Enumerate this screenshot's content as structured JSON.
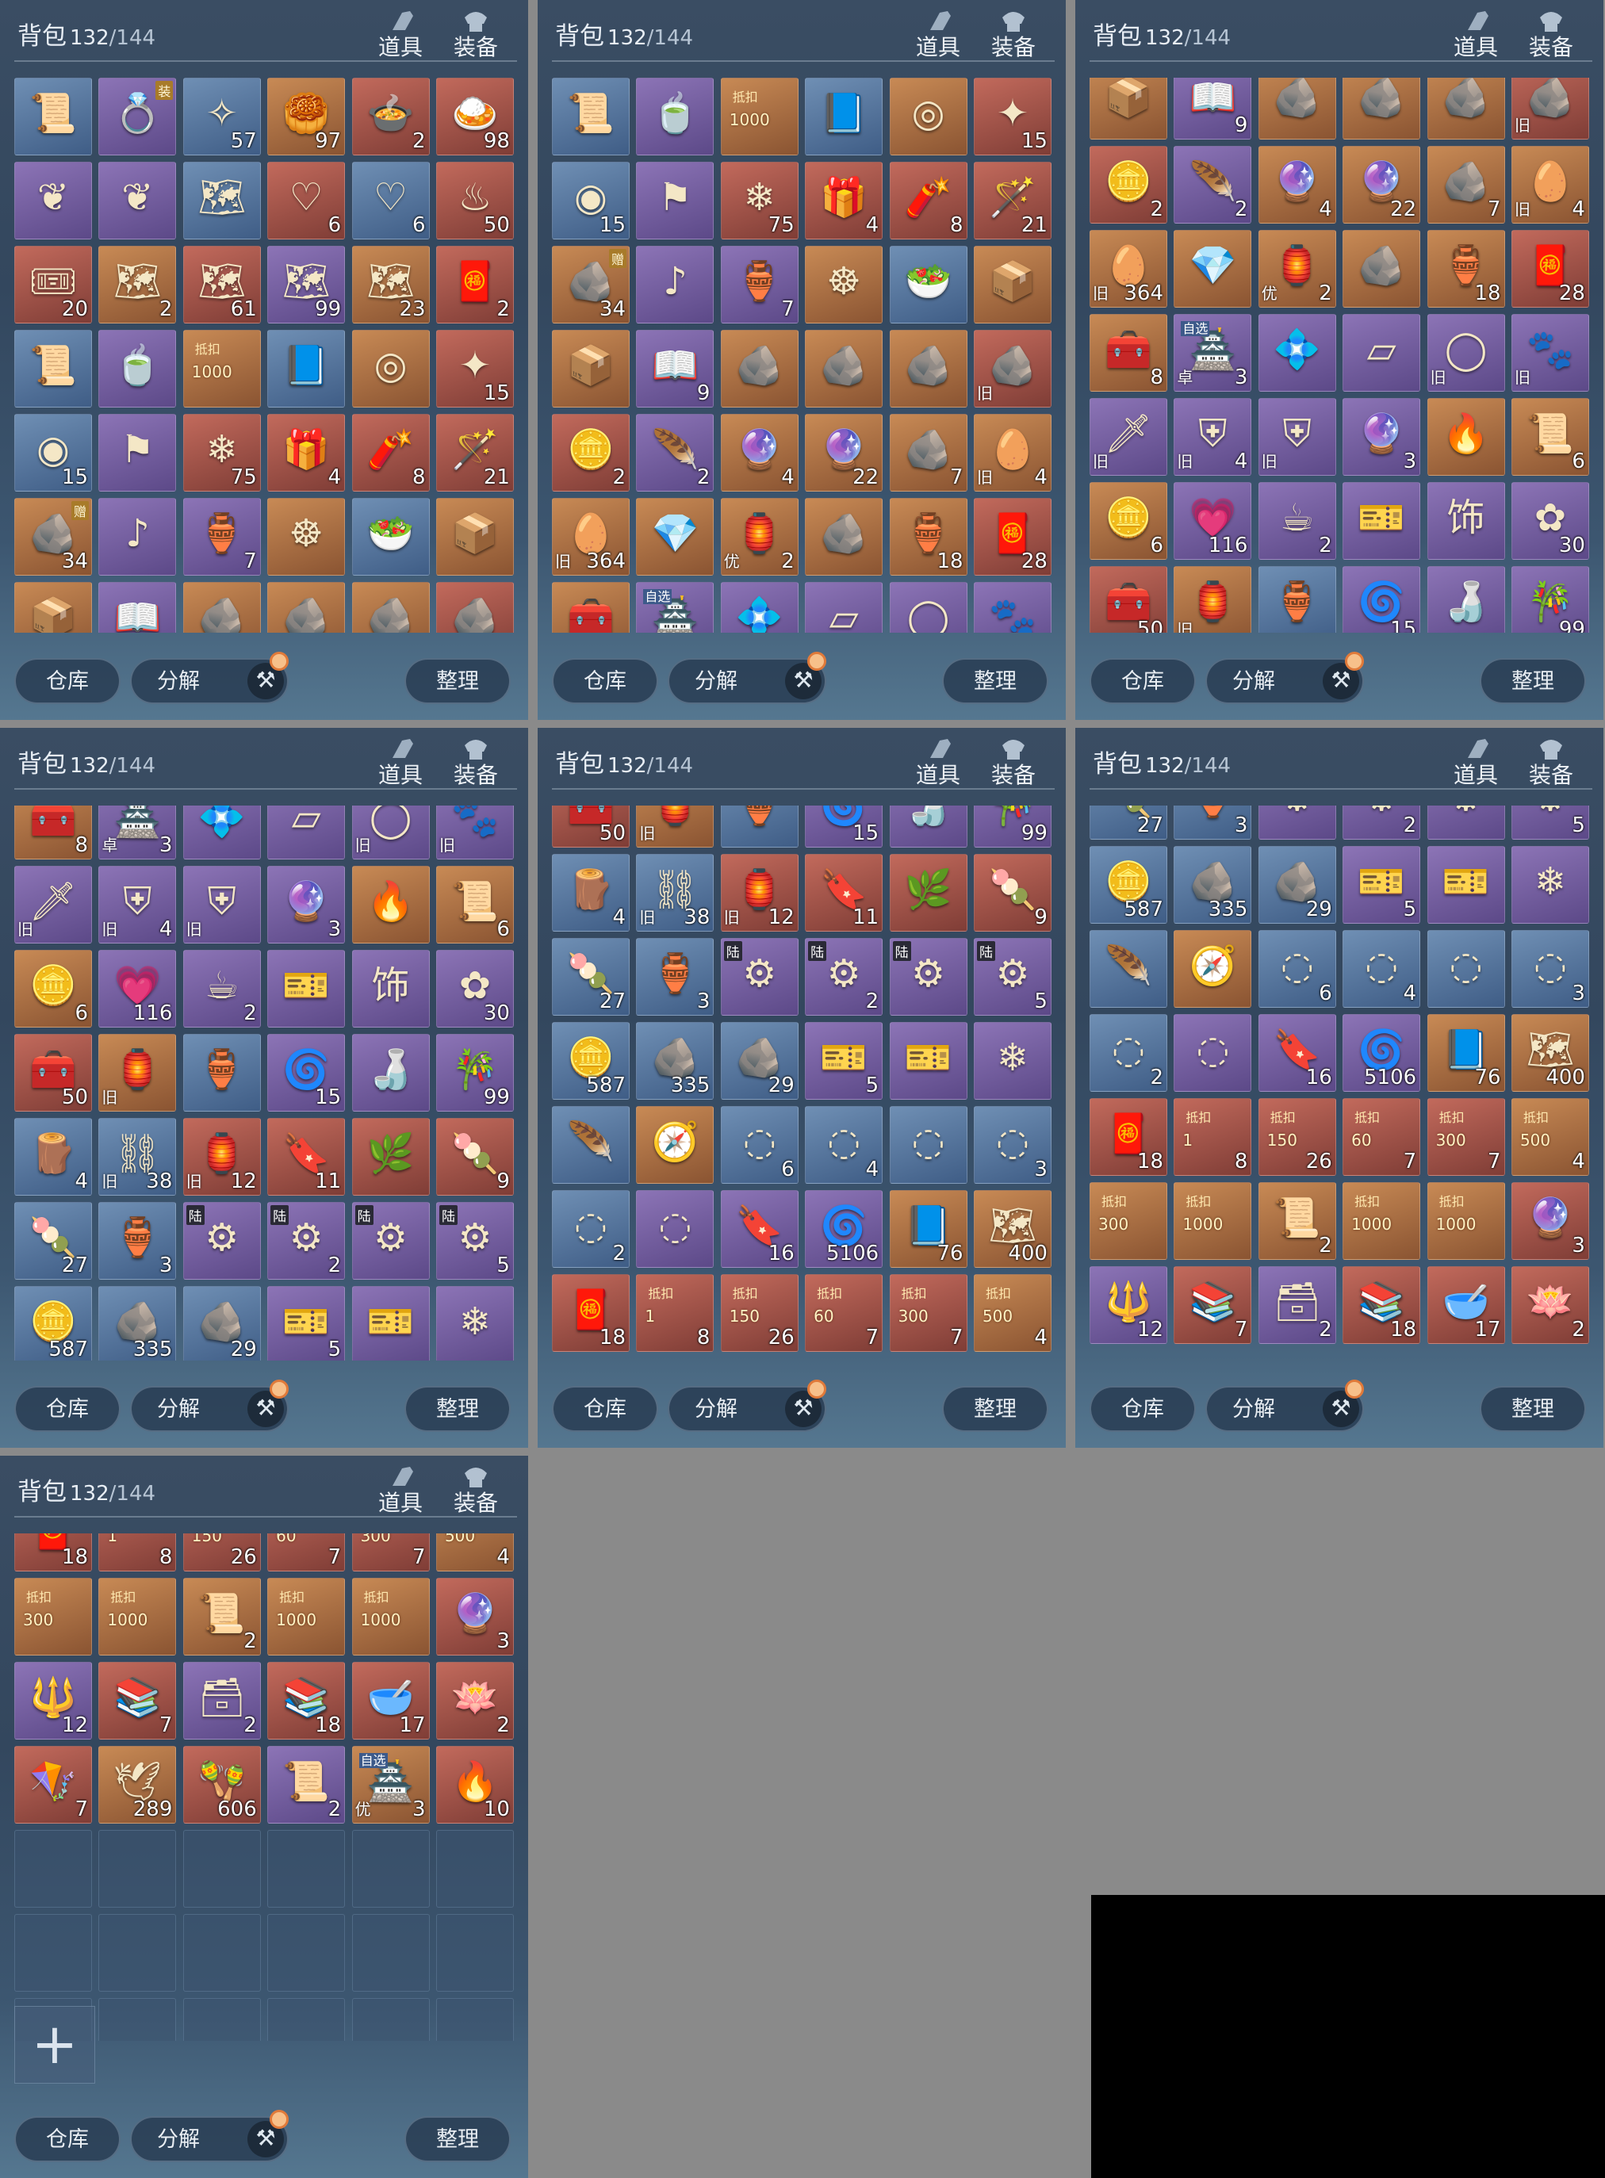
{
  "header": {
    "title": "背包",
    "used": "132",
    "max": "/144",
    "tab1": "道具",
    "tab2": "装备"
  },
  "footer": {
    "warehouse": "仓库",
    "decompose": "分解",
    "sort": "整理",
    "hammer": "⚒"
  },
  "plus": "+",
  "colors": {
    "blue": "#4f6f99",
    "purple": "#6e5a9e",
    "orange": "#a56a40",
    "red": "#9c4e45",
    "black": "#000000"
  },
  "items": [
    {
      "c": "blue",
      "i": "📜"
    },
    {
      "c": "purple",
      "i": "💍",
      "cr": "装"
    },
    {
      "c": "blue",
      "i": "✧",
      "q": "57"
    },
    {
      "c": "orange",
      "i": "🥮",
      "q": "97"
    },
    {
      "c": "red",
      "i": "🍲",
      "q": "2"
    },
    {
      "c": "red",
      "i": "🍛",
      "q": "98"
    },
    {
      "c": "purple",
      "i": "❦"
    },
    {
      "c": "purple",
      "i": "❦"
    },
    {
      "c": "blue",
      "i": "🗺"
    },
    {
      "c": "red",
      "i": "♡",
      "q": "6"
    },
    {
      "c": "blue",
      "i": "♡",
      "q": "6"
    },
    {
      "c": "red",
      "i": "♨",
      "q": "50"
    },
    {
      "c": "red",
      "i": "🎟",
      "q": "20"
    },
    {
      "c": "orange",
      "i": "🗺",
      "q": "2"
    },
    {
      "c": "red",
      "i": "🗺",
      "q": "61"
    },
    {
      "c": "purple",
      "i": "🗺",
      "q": "99"
    },
    {
      "c": "orange",
      "i": "🗺",
      "q": "23"
    },
    {
      "c": "red",
      "i": "🧧",
      "q": "2"
    },
    {
      "c": "blue",
      "i": "📜"
    },
    {
      "c": "purple",
      "i": "🍵"
    },
    {
      "c": "orange",
      "i": "",
      "st": "抵扣",
      "v": "1000"
    },
    {
      "c": "blue",
      "i": "📘"
    },
    {
      "c": "orange",
      "i": "◎"
    },
    {
      "c": "red",
      "i": "✦",
      "q": "15"
    },
    {
      "c": "blue",
      "i": "◉",
      "q": "15"
    },
    {
      "c": "purple",
      "i": "⚑"
    },
    {
      "c": "red",
      "i": "❄",
      "q": "75"
    },
    {
      "c": "red",
      "i": "🎁",
      "q": "4"
    },
    {
      "c": "red",
      "i": "🧨",
      "q": "8"
    },
    {
      "c": "red",
      "i": "🪄",
      "q": "21"
    },
    {
      "c": "orange",
      "i": "🪨",
      "q": "34",
      "cr": "赠"
    },
    {
      "c": "purple",
      "i": "♪"
    },
    {
      "c": "purple",
      "i": "🏺",
      "q": "7"
    },
    {
      "c": "orange",
      "i": "☸"
    },
    {
      "c": "blue",
      "i": "🥗"
    },
    {
      "c": "orange",
      "i": "📦"
    },
    {
      "c": "orange",
      "i": "📦"
    },
    {
      "c": "purple",
      "i": "📖",
      "q": "9"
    },
    {
      "c": "orange",
      "i": "🪨"
    },
    {
      "c": "orange",
      "i": "🪨"
    },
    {
      "c": "orange",
      "i": "🪨"
    },
    {
      "c": "red",
      "i": "🪨",
      "t": "旧"
    },
    {
      "c": "red",
      "i": "🪙",
      "q": "2"
    },
    {
      "c": "purple",
      "i": "🪶",
      "q": "2"
    },
    {
      "c": "orange",
      "i": "🔮",
      "q": "4"
    },
    {
      "c": "orange",
      "i": "🔮",
      "q": "22"
    },
    {
      "c": "orange",
      "i": "🪨",
      "q": "7"
    },
    {
      "c": "orange",
      "i": "🥚",
      "q": "4",
      "t": "旧"
    },
    {
      "c": "orange",
      "i": "🥚",
      "q": "364",
      "t": "旧"
    },
    {
      "c": "orange",
      "i": "💎"
    },
    {
      "c": "orange",
      "i": "🏮",
      "q": "2",
      "t": "优"
    },
    {
      "c": "orange",
      "i": "🪨"
    },
    {
      "c": "orange",
      "i": "🏺",
      "q": "18"
    },
    {
      "c": "red",
      "i": "🧧",
      "q": "28"
    },
    {
      "c": "orange",
      "i": "🧰",
      "q": "8"
    },
    {
      "c": "purple",
      "i": "🏯",
      "q": "3",
      "z": "自选",
      "t": "卓"
    },
    {
      "c": "purple",
      "i": "💠"
    },
    {
      "c": "purple",
      "i": "▱"
    },
    {
      "c": "purple",
      "i": "◯",
      "t": "旧"
    },
    {
      "c": "purple",
      "i": "🐾",
      "t": "旧"
    },
    {
      "c": "purple",
      "i": "🗡",
      "t": "旧"
    },
    {
      "c": "purple",
      "i": "⛨",
      "q": "4",
      "t": "旧"
    },
    {
      "c": "purple",
      "i": "⛨",
      "t": "旧"
    },
    {
      "c": "purple",
      "i": "🔮",
      "q": "3"
    },
    {
      "c": "orange",
      "i": "🔥"
    },
    {
      "c": "orange",
      "i": "📜",
      "q": "6"
    },
    {
      "c": "orange",
      "i": "🪙",
      "q": "6"
    },
    {
      "c": "purple",
      "i": "💗",
      "q": "116"
    },
    {
      "c": "purple",
      "i": "☕",
      "q": "2"
    },
    {
      "c": "purple",
      "i": "🎫"
    },
    {
      "c": "purple",
      "i": "饰"
    },
    {
      "c": "purple",
      "i": "✿",
      "q": "30"
    },
    {
      "c": "red",
      "i": "🧰",
      "q": "50"
    },
    {
      "c": "orange",
      "i": "🏮",
      "t": "旧"
    },
    {
      "c": "blue",
      "i": "🏺"
    },
    {
      "c": "purple",
      "i": "🌀",
      "q": "15"
    },
    {
      "c": "purple",
      "i": "🍶"
    },
    {
      "c": "purple",
      "i": "🎋",
      "q": "99"
    },
    {
      "c": "blue",
      "i": "🪵",
      "q": "4"
    },
    {
      "c": "blue",
      "i": "⛓",
      "q": "38",
      "t": "旧"
    },
    {
      "c": "red",
      "i": "🏮",
      "q": "12",
      "t": "旧"
    },
    {
      "c": "red",
      "i": "🔖",
      "q": "11"
    },
    {
      "c": "red",
      "i": "🌿"
    },
    {
      "c": "red",
      "i": "🍡",
      "q": "9"
    },
    {
      "c": "blue",
      "i": "🍡",
      "q": "27"
    },
    {
      "c": "blue",
      "i": "🏺",
      "q": "3"
    },
    {
      "c": "purple",
      "i": "⚙",
      "cr2": "陆"
    },
    {
      "c": "purple",
      "i": "⚙",
      "q": "2",
      "cr2": "陆"
    },
    {
      "c": "purple",
      "i": "⚙",
      "cr2": "陆"
    },
    {
      "c": "purple",
      "i": "⚙",
      "q": "5",
      "cr2": "陆"
    },
    {
      "c": "blue",
      "i": "🪙",
      "q": "587"
    },
    {
      "c": "blue",
      "i": "🪨",
      "q": "335"
    },
    {
      "c": "blue",
      "i": "🪨",
      "q": "29"
    },
    {
      "c": "purple",
      "i": "🎫",
      "q": "5"
    },
    {
      "c": "purple",
      "i": "🎫"
    },
    {
      "c": "purple",
      "i": "❄"
    },
    {
      "c": "blue",
      "i": "🪶"
    },
    {
      "c": "orange",
      "i": "🧭"
    },
    {
      "c": "blue",
      "i": "◌",
      "q": "6"
    },
    {
      "c": "blue",
      "i": "◌",
      "q": "4"
    },
    {
      "c": "blue",
      "i": "◌"
    },
    {
      "c": "blue",
      "i": "◌",
      "q": "3"
    },
    {
      "c": "blue",
      "i": "◌",
      "q": "2"
    },
    {
      "c": "purple",
      "i": "◌"
    },
    {
      "c": "purple",
      "i": "🔖",
      "q": "16"
    },
    {
      "c": "purple",
      "i": "🌀",
      "q": "5106"
    },
    {
      "c": "orange",
      "i": "📘",
      "q": "76"
    },
    {
      "c": "orange",
      "i": "🗺",
      "q": "400"
    },
    {
      "c": "red",
      "i": "🧧",
      "q": "18"
    },
    {
      "c": "red",
      "i": "",
      "st": "抵扣",
      "v": "1",
      "q": "8"
    },
    {
      "c": "red",
      "i": "",
      "st": "抵扣",
      "v": "150",
      "q": "26"
    },
    {
      "c": "red",
      "i": "",
      "st": "抵扣",
      "v": "60",
      "q": "7"
    },
    {
      "c": "red",
      "i": "",
      "st": "抵扣",
      "v": "300",
      "q": "7"
    },
    {
      "c": "orange",
      "i": "",
      "st": "抵扣",
      "v": "500",
      "q": "4"
    },
    {
      "c": "orange",
      "i": "",
      "st": "抵扣",
      "v": "300"
    },
    {
      "c": "orange",
      "i": "",
      "st": "抵扣",
      "v": "1000"
    },
    {
      "c": "orange",
      "i": "📜",
      "q": "2"
    },
    {
      "c": "orange",
      "i": "",
      "st": "抵扣",
      "v": "1000"
    },
    {
      "c": "orange",
      "i": "",
      "st": "抵扣",
      "v": "1000"
    },
    {
      "c": "red",
      "i": "🔮",
      "q": "3"
    },
    {
      "c": "purple",
      "i": "🔱",
      "q": "12"
    },
    {
      "c": "red",
      "i": "📚",
      "q": "7"
    },
    {
      "c": "purple",
      "i": "🗃",
      "q": "2"
    },
    {
      "c": "red",
      "i": "📚",
      "q": "18"
    },
    {
      "c": "red",
      "i": "🥣",
      "q": "17"
    },
    {
      "c": "red",
      "i": "🪷",
      "q": "2"
    },
    {
      "c": "red",
      "i": "🪁",
      "q": "7"
    },
    {
      "c": "orange",
      "i": "🕊",
      "q": "289"
    },
    {
      "c": "red",
      "i": "🪇",
      "q": "606"
    },
    {
      "c": "purple",
      "i": "📜",
      "q": "2"
    },
    {
      "c": "orange",
      "i": "🏯",
      "q": "3",
      "z": "自选",
      "t": "优"
    },
    {
      "c": "red",
      "i": "🔥",
      "q": "10"
    }
  ],
  "panels": [
    {
      "start": 0,
      "rows": 7,
      "offset": 0
    },
    {
      "start": 18,
      "rows": 7,
      "offset": 0
    },
    {
      "start": 36,
      "rows": 7,
      "offset": 0
    },
    {
      "start": 54,
      "rows": 7,
      "offset": 0
    },
    {
      "start": 72,
      "rows": 7,
      "offset": 0
    },
    {
      "start": 84,
      "rows": 7,
      "offset": 0
    },
    {
      "start": 108,
      "rows": 6,
      "offset": 0
    }
  ]
}
